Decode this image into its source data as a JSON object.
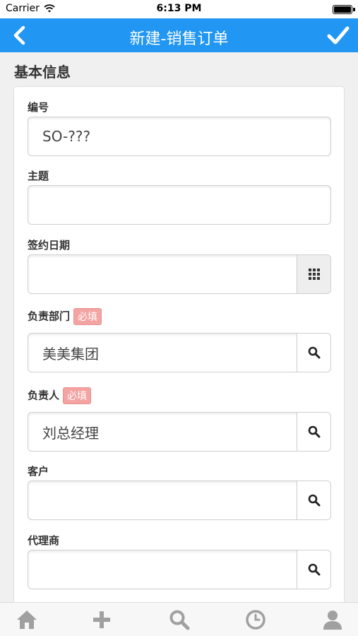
{
  "status": {
    "carrier": "Carrier",
    "time": "6:13 PM"
  },
  "nav": {
    "title": "新建-销售订单"
  },
  "section": {
    "title": "基本信息"
  },
  "fields": {
    "number": {
      "label": "编号",
      "value": "SO-???"
    },
    "subject": {
      "label": "主题",
      "value": ""
    },
    "date": {
      "label": "签约日期",
      "value": ""
    },
    "department": {
      "label": "负责部门",
      "badge": "必填",
      "value": "美美集团"
    },
    "owner": {
      "label": "负责人",
      "badge": "必填",
      "value": "刘总经理"
    },
    "customer": {
      "label": "客户",
      "value": ""
    },
    "agent": {
      "label": "代理商",
      "value": ""
    }
  },
  "colors": {
    "accent": "#2196f3",
    "required": "#f4a3a3"
  },
  "icons": {
    "back": "chevron-left-icon",
    "confirm": "checkmark-icon",
    "calendar": "grid-icon",
    "search": "search-icon",
    "tabs": [
      "home-icon",
      "plus-icon",
      "search-icon",
      "clock-icon",
      "user-icon"
    ]
  }
}
